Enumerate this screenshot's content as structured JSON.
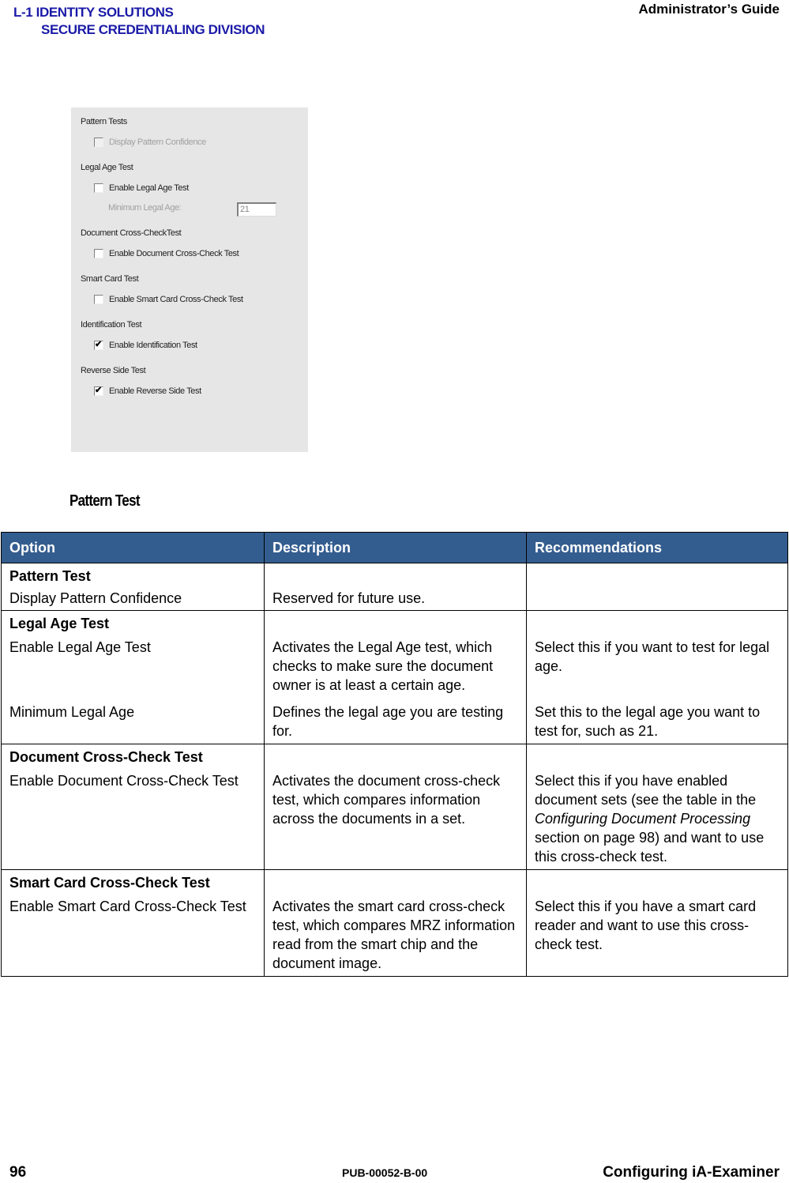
{
  "header": {
    "logo_line1": "L-1 IDENTITY SOLUTIONS",
    "logo_line2": "SECURE CREDENTIALING DIVISION",
    "guide_title": "Administrator’s Guide",
    "logo_color": "#1a1aa8"
  },
  "screenshot": {
    "groups": [
      {
        "title": "Pattern Tests",
        "checkbox_label": "Display Pattern Confidence",
        "checked": false,
        "disabled": true
      },
      {
        "title": "Legal Age Test",
        "checkbox_label": "Enable Legal Age Test",
        "checked": false,
        "disabled": false
      },
      {
        "title": "Document Cross-CheckTest",
        "checkbox_label": "Enable Document Cross-Check Test",
        "checked": false,
        "disabled": false
      },
      {
        "title": "Smart Card Test",
        "checkbox_label": "Enable Smart Card Cross-Check Test",
        "checked": false,
        "disabled": false
      },
      {
        "title": "Identification Test",
        "checkbox_label": "Enable Identification Test",
        "checked": true,
        "disabled": false
      },
      {
        "title": "Reverse Side Test",
        "checkbox_label": "Enable Reverse Side Test",
        "checked": true,
        "disabled": false
      }
    ],
    "min_legal_age_label": "Minimum Legal Age:",
    "min_legal_age_value": "21",
    "check_glyph": "✔"
  },
  "section_title": "Pattern Test",
  "table": {
    "header_color": "#345d8f",
    "columns": [
      "Option",
      "Description",
      "Recommendations"
    ],
    "groups": [
      {
        "title": "Pattern Test",
        "rows": [
          {
            "option": "Display Pattern Confidence",
            "description": "Reserved for future use.",
            "recommendation": ""
          }
        ]
      },
      {
        "title": "Legal Age Test",
        "rows": [
          {
            "option": "Enable Legal Age Test",
            "description": "Activates the Legal Age test, which checks to make sure the document owner is at least a certain age.",
            "recommendation": "Select this if you want to test for legal age."
          },
          {
            "option": "Minimum Legal Age",
            "description": "Defines the legal age you are testing for.",
            "recommendation": "Set this to the legal age you want to test for, such as 21."
          }
        ]
      },
      {
        "title": "Document Cross-Check Test",
        "rows": [
          {
            "option": "Enable Document Cross-Check Test",
            "description": "Activates the document cross-check test, which compares information across the documents in a set.",
            "recommendation_parts": {
              "pre": "Select this if you have enabled document sets (see the table in the ",
              "italic": "Configuring Document Processing",
              "post": " section on page 98) and want to use this cross-check test."
            }
          }
        ]
      },
      {
        "title": "Smart Card Cross-Check Test",
        "rows": [
          {
            "option": "Enable Smart Card Cross-Check Test",
            "description": "Activates the smart card cross-check test, which compares MRZ information read from the smart chip and the document image.",
            "recommendation": "Select this if you have a smart card reader and want to use this cross-check test."
          }
        ]
      }
    ]
  },
  "footer": {
    "page_number": "96",
    "publication_id": "PUB-00052-B-00",
    "chapter": "Configuring iA-Examiner"
  }
}
